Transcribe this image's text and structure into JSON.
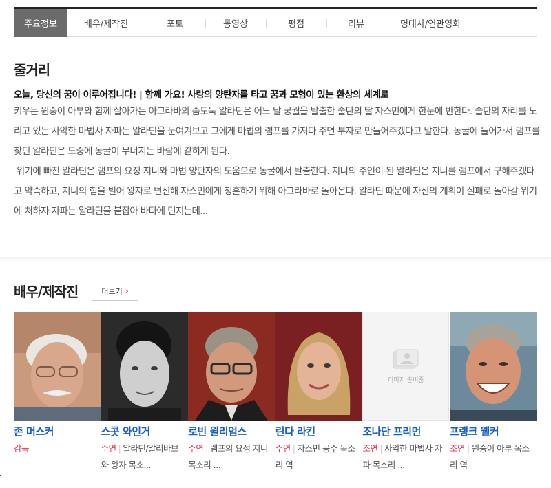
{
  "tabs": [
    {
      "label": "주요정보",
      "active": true
    },
    {
      "label": "배우/제작진",
      "active": false
    },
    {
      "label": "포토",
      "active": false
    },
    {
      "label": "동영상",
      "active": false
    },
    {
      "label": "평점",
      "active": false
    },
    {
      "label": "리뷰",
      "active": false
    },
    {
      "label": "명대사/연관영화",
      "active": false
    }
  ],
  "synopsis": {
    "title": "줄거리",
    "tagline": "오늘, 당신의 꿈이 이루어집니다! | 함께 가요! 사랑의 양탄자를 타고 꿈과 모험이 있는 환상의 세계로",
    "paragraph1": "키우는 원숭이 아부와 함께 살아가는 아그라바의 좀도둑 알라딘은 어느 날 궁궐을 탈출한 술탄의 딸 자스민에게 한눈에 반한다. 술탄의 자리를 노리고 있는 사악한 마법사 자파는 알라딘을 눈여겨보고 그에게 마법의 램프를 가져다 주면 부자로 만들어주겠다고 말한다. 동굴에 들어가서 램프를 찾던 알라딘은 도중에 동굴이 무너지는 바람에 갇히게 된다.",
    "paragraph2": " 위기에 빠진 알라딘은 램프의 요정 지니와 마법 양탄자의 도움으로 동굴에서 탈출한다. 지니의 주인이 된 알라딘은 지니를 램프에서 구해주겠다고 약속하고, 지니의 힘을 빌어 왕자로 변신해 자스민에게 청혼하기 위해 아그라바로 돌아온다. 알라딘 때문에 자신의 계획이 실패로 돌아갈 위기에 처하자 자파는 알라딘을 붙잡아 바다에 던지는데..."
  },
  "cast_section": {
    "title": "배우/제작진",
    "more_label": "더보기",
    "image_placeholder_text": "이미지 준비중"
  },
  "cast": [
    {
      "name": "존 머스커",
      "role_type": "감독",
      "role": "",
      "photo": "portrait-white-haired-man-glasses"
    },
    {
      "name": "스콧 와인거",
      "role_type": "주연",
      "role": "알라딘/알리바브와 왕자 목소...",
      "photo": "portrait-dark-haired-young-man"
    },
    {
      "name": "로빈 윌리엄스",
      "role_type": "주연",
      "role": "램프의 요정 지니 목소리 ...",
      "photo": "portrait-man-glasses-suit"
    },
    {
      "name": "린다 라킨",
      "role_type": "주연",
      "role": "자스민 공주 목소리 역",
      "photo": "portrait-blonde-woman"
    },
    {
      "name": "조나단 프리먼",
      "role_type": "조연",
      "role": "사악한 마법사 자파 목소리 ...",
      "photo": "image-placeholder"
    },
    {
      "name": "프랭크 웰커",
      "role_type": "조연",
      "role": "원숭이 아부 목소리 역",
      "photo": "portrait-smiling-man"
    }
  ],
  "colors": {
    "accent": "#e8344e",
    "link": "#1a5fc9",
    "active_tab": "#6b6b6b"
  }
}
